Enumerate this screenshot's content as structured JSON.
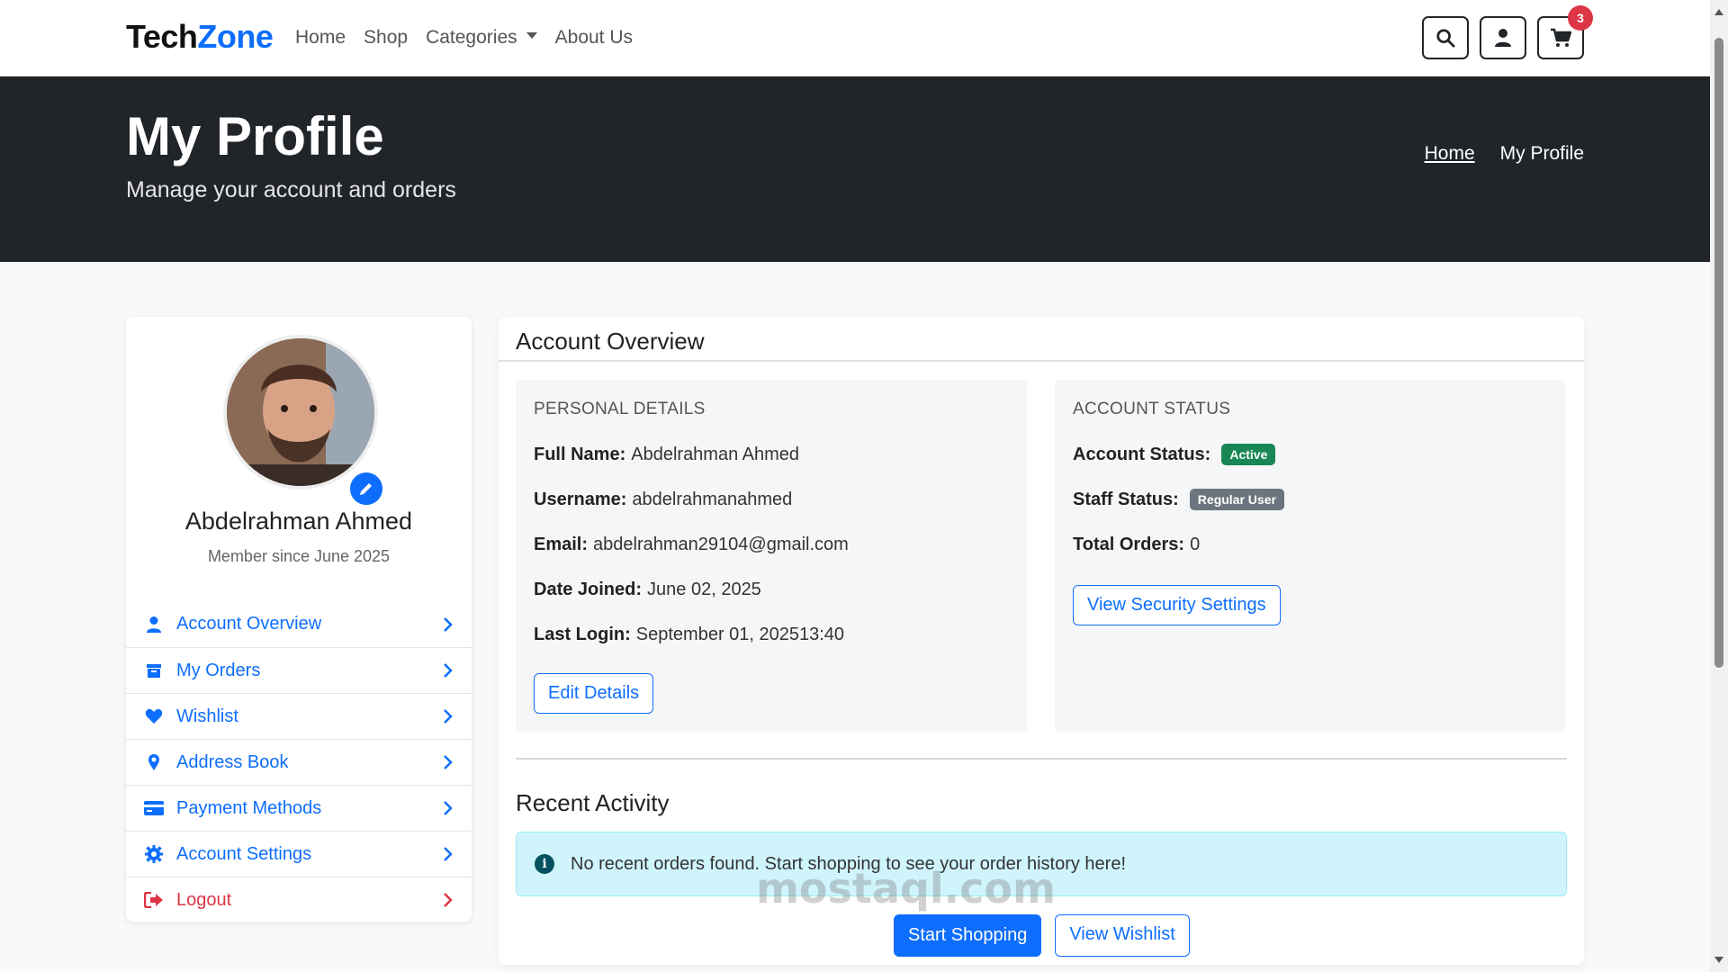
{
  "navbar": {
    "brand_part1": "Tech",
    "brand_part2": "Zone",
    "links": [
      "Home",
      "Shop",
      "Categories",
      "About Us"
    ],
    "cart_count": "3"
  },
  "hero": {
    "title": "My Profile",
    "subtitle": "Manage your account and orders",
    "breadcrumb_home": "Home",
    "breadcrumb_current": "My Profile"
  },
  "profile": {
    "name": "Abdelrahman Ahmed",
    "member_since": "Member since June 2025"
  },
  "sidebar": {
    "items": [
      {
        "label": "Account Overview",
        "icon": "user-icon"
      },
      {
        "label": "My Orders",
        "icon": "box-icon"
      },
      {
        "label": "Wishlist",
        "icon": "heart-icon"
      },
      {
        "label": "Address Book",
        "icon": "map-pin-icon"
      },
      {
        "label": "Payment Methods",
        "icon": "credit-card-icon"
      },
      {
        "label": "Account Settings",
        "icon": "gear-icon"
      },
      {
        "label": "Logout",
        "icon": "logout-icon"
      }
    ]
  },
  "main": {
    "header": "Account Overview",
    "personal": {
      "heading": "PERSONAL DETAILS",
      "full_name_label": "Full Name:",
      "full_name": "Abdelrahman Ahmed",
      "username_label": "Username:",
      "username": "abdelrahmanahmed",
      "email_label": "Email:",
      "email": "abdelrahman29104@gmail.com",
      "joined_label": "Date Joined:",
      "joined": "June 02, 2025",
      "login_label": "Last Login:",
      "login": "September 01, 202513:40",
      "edit_button": "Edit Details"
    },
    "status": {
      "heading": "ACCOUNT STATUS",
      "account_status_label": "Account Status:",
      "account_status": "Active",
      "staff_status_label": "Staff Status:",
      "staff_status": "Regular User",
      "total_orders_label": "Total Orders:",
      "total_orders": "0",
      "security_button": "View Security Settings"
    },
    "recent": {
      "title": "Recent Activity",
      "alert": "No recent orders found. Start shopping to see your order history here!",
      "start_shopping": "Start Shopping",
      "view_wishlist": "View Wishlist"
    }
  },
  "colors": {
    "primary": "#0d6efd",
    "dark": "#212529",
    "danger": "#dc3545",
    "success": "#198754",
    "info_bg": "#cff4fc"
  },
  "watermark": "mostaql.com"
}
